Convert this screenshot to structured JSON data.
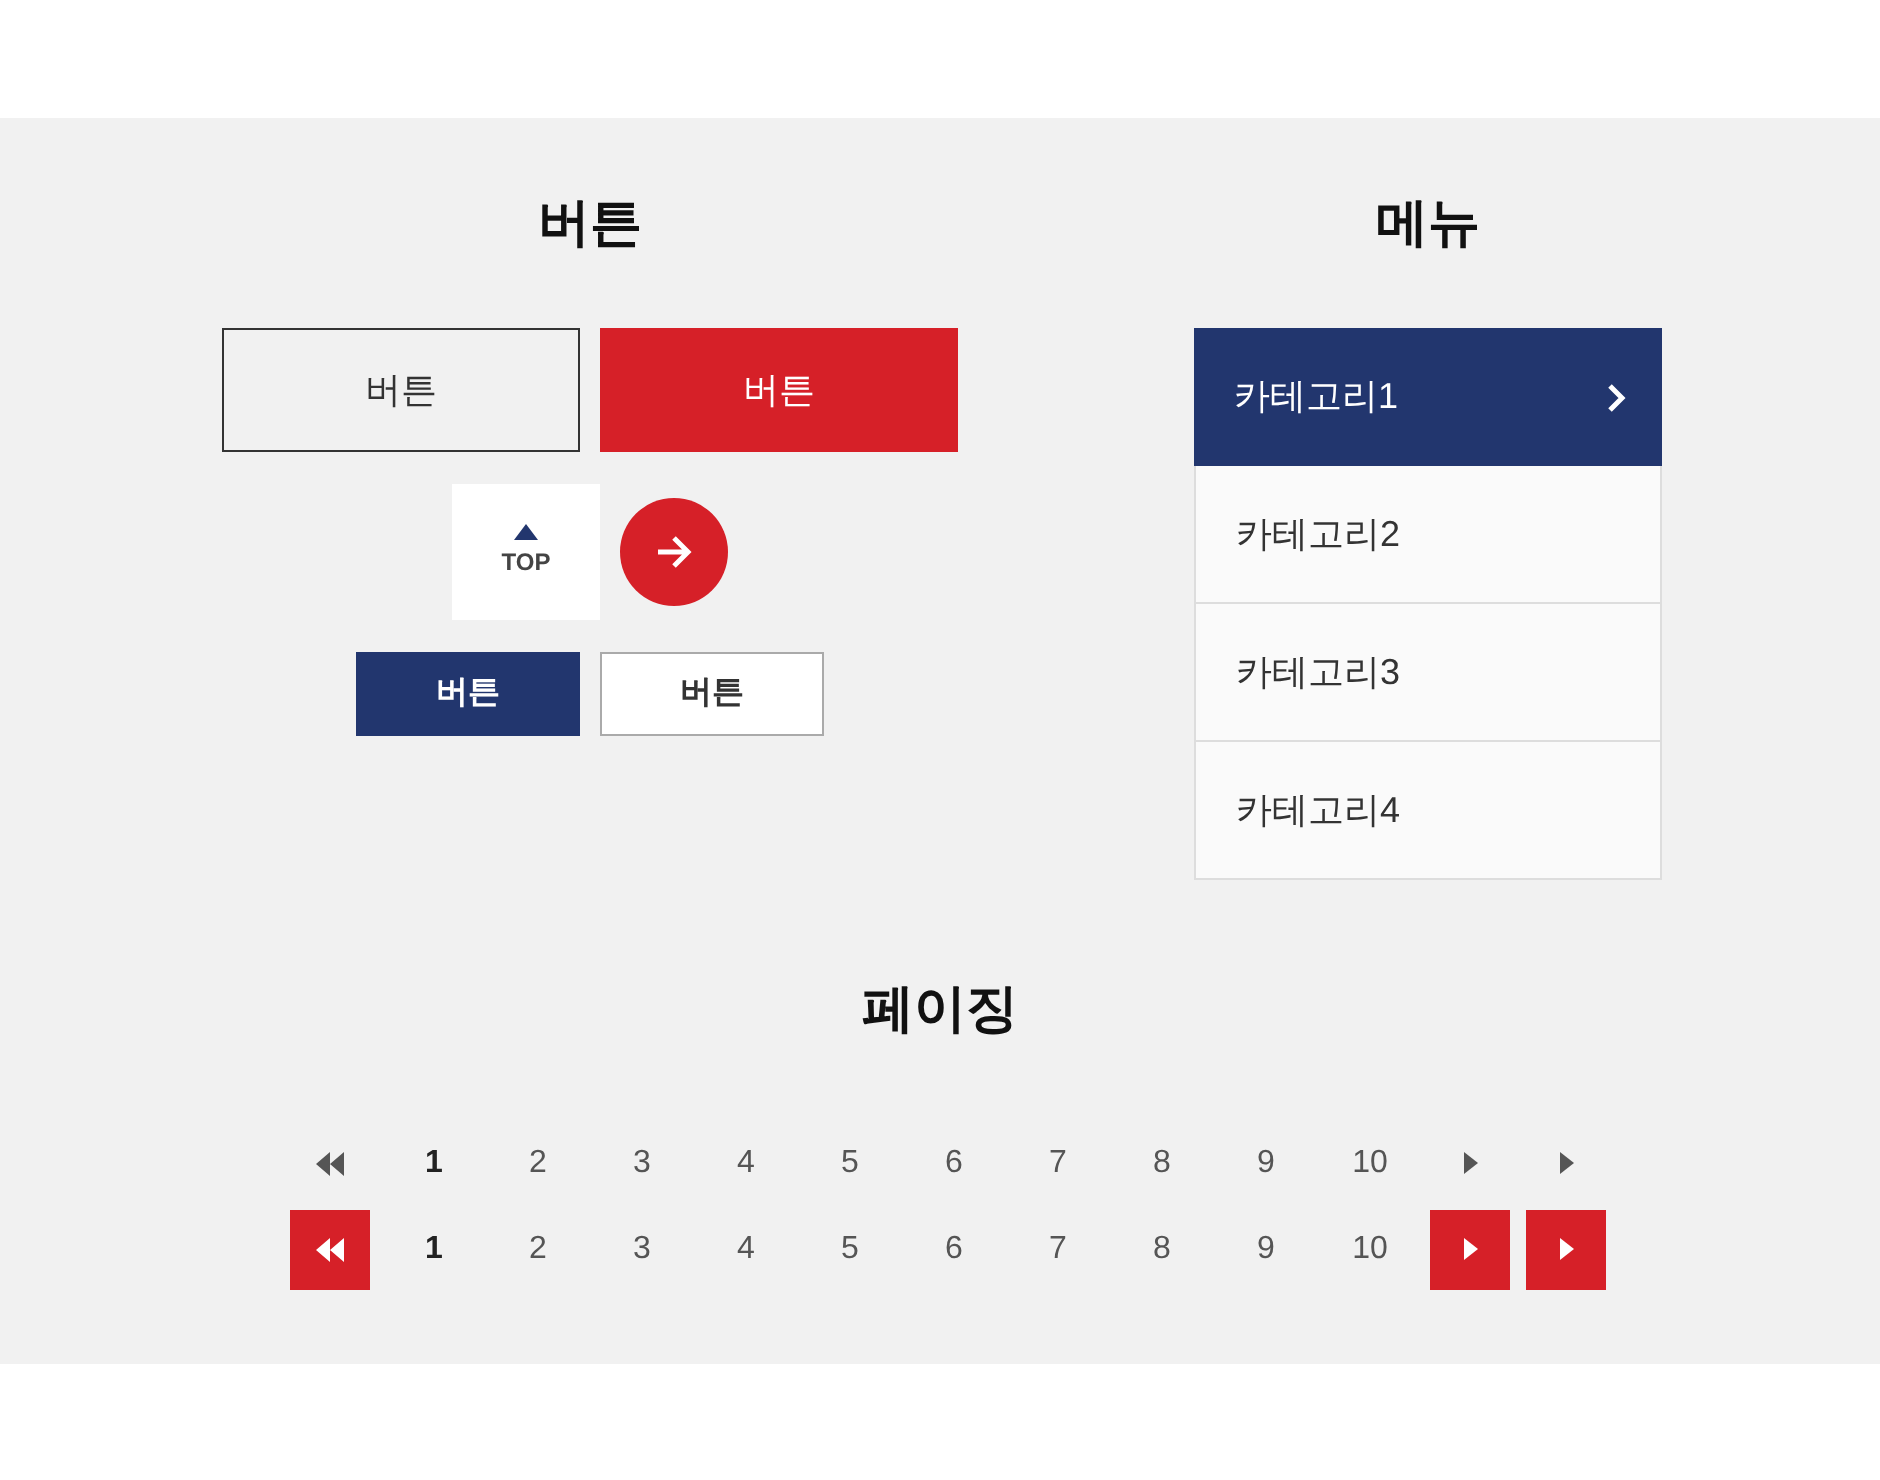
{
  "buttons_section": {
    "title": "버튼",
    "buttons": [
      {
        "label": "버튼",
        "kind": "outline"
      },
      {
        "label": "버튼",
        "kind": "red"
      }
    ],
    "top_button": {
      "label": "TOP"
    },
    "small_buttons": [
      {
        "label": "버튼",
        "kind": "navy"
      },
      {
        "label": "버튼",
        "kind": "white"
      }
    ]
  },
  "menu_section": {
    "title": "메뉴",
    "items": [
      {
        "label": "카테고리1",
        "selected": true
      },
      {
        "label": "카테고리2",
        "selected": false
      },
      {
        "label": "카테고리3",
        "selected": false
      },
      {
        "label": "카테고리4",
        "selected": false
      }
    ]
  },
  "paging_section": {
    "title": "페이징",
    "rows": [
      {
        "kind": "plain",
        "pages": [
          {
            "label": "1",
            "selected": true
          },
          {
            "label": "2",
            "selected": false
          },
          {
            "label": "3",
            "selected": false
          },
          {
            "label": "4",
            "selected": false
          },
          {
            "label": "5",
            "selected": false
          },
          {
            "label": "6",
            "selected": false
          },
          {
            "label": "7",
            "selected": false
          },
          {
            "label": "8",
            "selected": false
          },
          {
            "label": "9",
            "selected": false
          },
          {
            "label": "10",
            "selected": false
          }
        ]
      },
      {
        "kind": "boxed",
        "pages": [
          {
            "label": "1",
            "selected": true
          },
          {
            "label": "2",
            "selected": false
          },
          {
            "label": "3",
            "selected": false
          },
          {
            "label": "4",
            "selected": false
          },
          {
            "label": "5",
            "selected": false
          },
          {
            "label": "6",
            "selected": false
          },
          {
            "label": "7",
            "selected": false
          },
          {
            "label": "8",
            "selected": false
          },
          {
            "label": "9",
            "selected": false
          },
          {
            "label": "10",
            "selected": false
          }
        ]
      }
    ]
  }
}
